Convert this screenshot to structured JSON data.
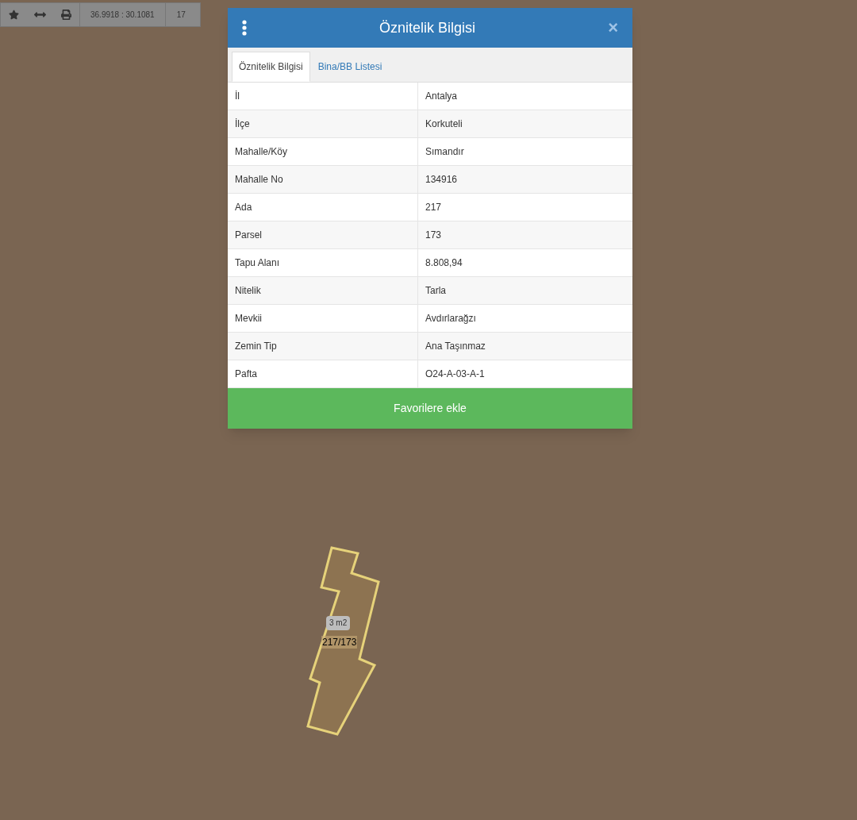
{
  "toolbar": {
    "coordinates": "36.9918 : 30.1081",
    "zoom_level": "17"
  },
  "dialog": {
    "title": "Öznitelik Bilgisi",
    "close": "×",
    "tabs": [
      {
        "label": "Öznitelik Bilgisi",
        "selected": true
      },
      {
        "label": "Bina/BB Listesi",
        "selected": false
      }
    ],
    "rows": [
      {
        "label": "İl",
        "value": "Antalya"
      },
      {
        "label": "İlçe",
        "value": "Korkuteli"
      },
      {
        "label": "Mahalle/Köy",
        "value": "Sımandır"
      },
      {
        "label": "Mahalle No",
        "value": "134916"
      },
      {
        "label": "Ada",
        "value": "217"
      },
      {
        "label": "Parsel",
        "value": "173"
      },
      {
        "label": "Tapu Alanı",
        "value": "8.808,94"
      },
      {
        "label": "Nitelik",
        "value": "Tarla"
      },
      {
        "label": "Mevkii",
        "value": "Avdırlarağzı"
      },
      {
        "label": "Zemin Tip",
        "value": "Ana Taşınmaz"
      },
      {
        "label": "Pafta",
        "value": "O24-A-03-A-1"
      }
    ],
    "button": "Favorilere ekle"
  },
  "map": {
    "area_label": "3 m2",
    "parcel_label": "217/173"
  }
}
